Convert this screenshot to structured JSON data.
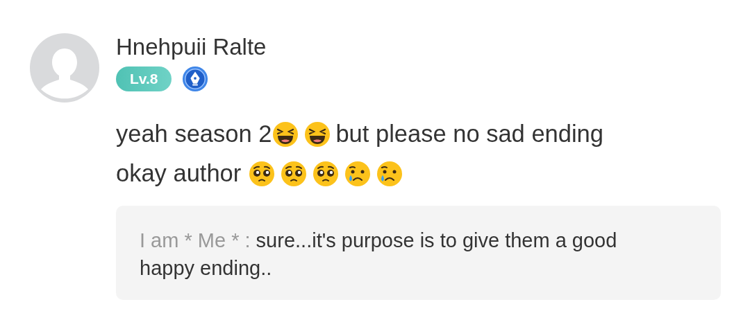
{
  "comment": {
    "author": "Hnehpuii Ralte",
    "level_badge": "Lv.8",
    "body": [
      {
        "kind": "text",
        "text": "yeah season 2"
      },
      {
        "kind": "laugh"
      },
      {
        "kind": "laugh"
      },
      {
        "kind": "text",
        "text": "but please no sad ending"
      },
      {
        "kind": "text",
        "text": "okay author "
      },
      {
        "kind": "plead"
      },
      {
        "kind": "plead"
      },
      {
        "kind": "plead"
      },
      {
        "kind": "cry"
      },
      {
        "kind": "cry"
      }
    ],
    "reply": {
      "author": "I am * Me * :",
      "text": "sure...it's purpose is to give them a good happy ending.."
    }
  }
}
